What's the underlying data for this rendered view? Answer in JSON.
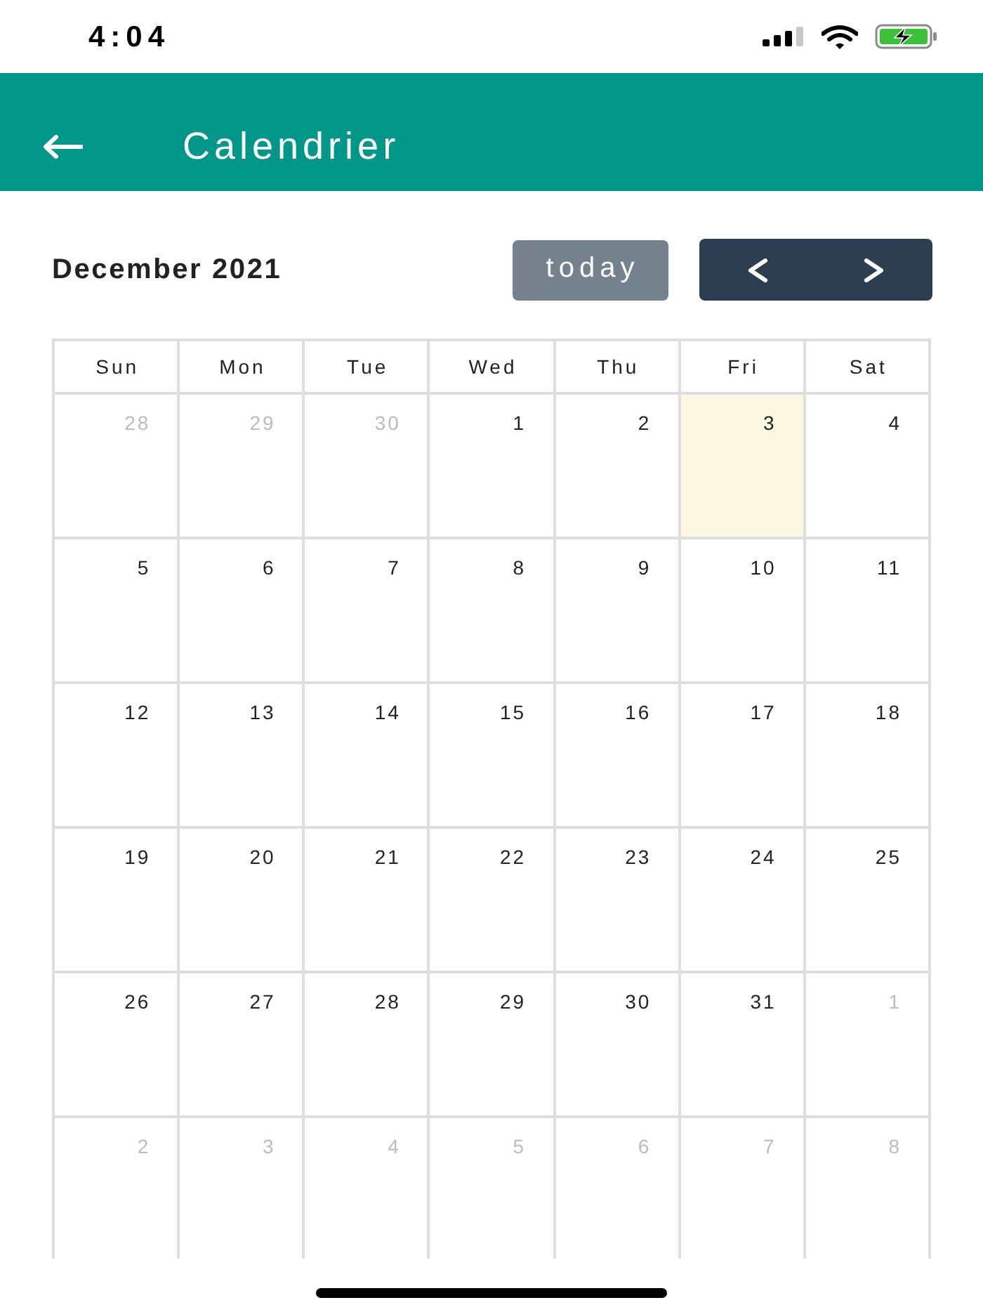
{
  "status_bar": {
    "time": "4:04"
  },
  "header": {
    "title": "Calendrier"
  },
  "toolbar": {
    "month_title": "December 2021",
    "today_button": {
      "label": "today",
      "disabled": true
    }
  },
  "calendar": {
    "weekdays": [
      "Sun",
      "Mon",
      "Tue",
      "Wed",
      "Thu",
      "Fri",
      "Sat"
    ],
    "weeks": [
      {
        "days": [
          {
            "label": "28",
            "outside_month": true,
            "today": false
          },
          {
            "label": "29",
            "outside_month": true,
            "today": false
          },
          {
            "label": "30",
            "outside_month": true,
            "today": false
          },
          {
            "label": "1",
            "outside_month": false,
            "today": false
          },
          {
            "label": "2",
            "outside_month": false,
            "today": false
          },
          {
            "label": "3",
            "outside_month": false,
            "today": true
          },
          {
            "label": "4",
            "outside_month": false,
            "today": false
          }
        ]
      },
      {
        "days": [
          {
            "label": "5",
            "outside_month": false,
            "today": false
          },
          {
            "label": "6",
            "outside_month": false,
            "today": false
          },
          {
            "label": "7",
            "outside_month": false,
            "today": false
          },
          {
            "label": "8",
            "outside_month": false,
            "today": false
          },
          {
            "label": "9",
            "outside_month": false,
            "today": false
          },
          {
            "label": "10",
            "outside_month": false,
            "today": false
          },
          {
            "label": "11",
            "outside_month": false,
            "today": false
          }
        ]
      },
      {
        "days": [
          {
            "label": "12",
            "outside_month": false,
            "today": false
          },
          {
            "label": "13",
            "outside_month": false,
            "today": false
          },
          {
            "label": "14",
            "outside_month": false,
            "today": false
          },
          {
            "label": "15",
            "outside_month": false,
            "today": false
          },
          {
            "label": "16",
            "outside_month": false,
            "today": false
          },
          {
            "label": "17",
            "outside_month": false,
            "today": false
          },
          {
            "label": "18",
            "outside_month": false,
            "today": false
          }
        ]
      },
      {
        "days": [
          {
            "label": "19",
            "outside_month": false,
            "today": false
          },
          {
            "label": "20",
            "outside_month": false,
            "today": false
          },
          {
            "label": "21",
            "outside_month": false,
            "today": false
          },
          {
            "label": "22",
            "outside_month": false,
            "today": false
          },
          {
            "label": "23",
            "outside_month": false,
            "today": false
          },
          {
            "label": "24",
            "outside_month": false,
            "today": false
          },
          {
            "label": "25",
            "outside_month": false,
            "today": false
          }
        ]
      },
      {
        "days": [
          {
            "label": "26",
            "outside_month": false,
            "today": false
          },
          {
            "label": "27",
            "outside_month": false,
            "today": false
          },
          {
            "label": "28",
            "outside_month": false,
            "today": false
          },
          {
            "label": "29",
            "outside_month": false,
            "today": false
          },
          {
            "label": "30",
            "outside_month": false,
            "today": false
          },
          {
            "label": "31",
            "outside_month": false,
            "today": false
          },
          {
            "label": "1",
            "outside_month": true,
            "today": false
          }
        ]
      },
      {
        "days": [
          {
            "label": "2",
            "outside_month": true,
            "today": false
          },
          {
            "label": "3",
            "outside_month": true,
            "today": false
          },
          {
            "label": "4",
            "outside_month": true,
            "today": false
          },
          {
            "label": "5",
            "outside_month": true,
            "today": false
          },
          {
            "label": "6",
            "outside_month": true,
            "today": false
          },
          {
            "label": "7",
            "outside_month": true,
            "today": false
          },
          {
            "label": "8",
            "outside_month": true,
            "today": false
          }
        ]
      }
    ]
  }
}
